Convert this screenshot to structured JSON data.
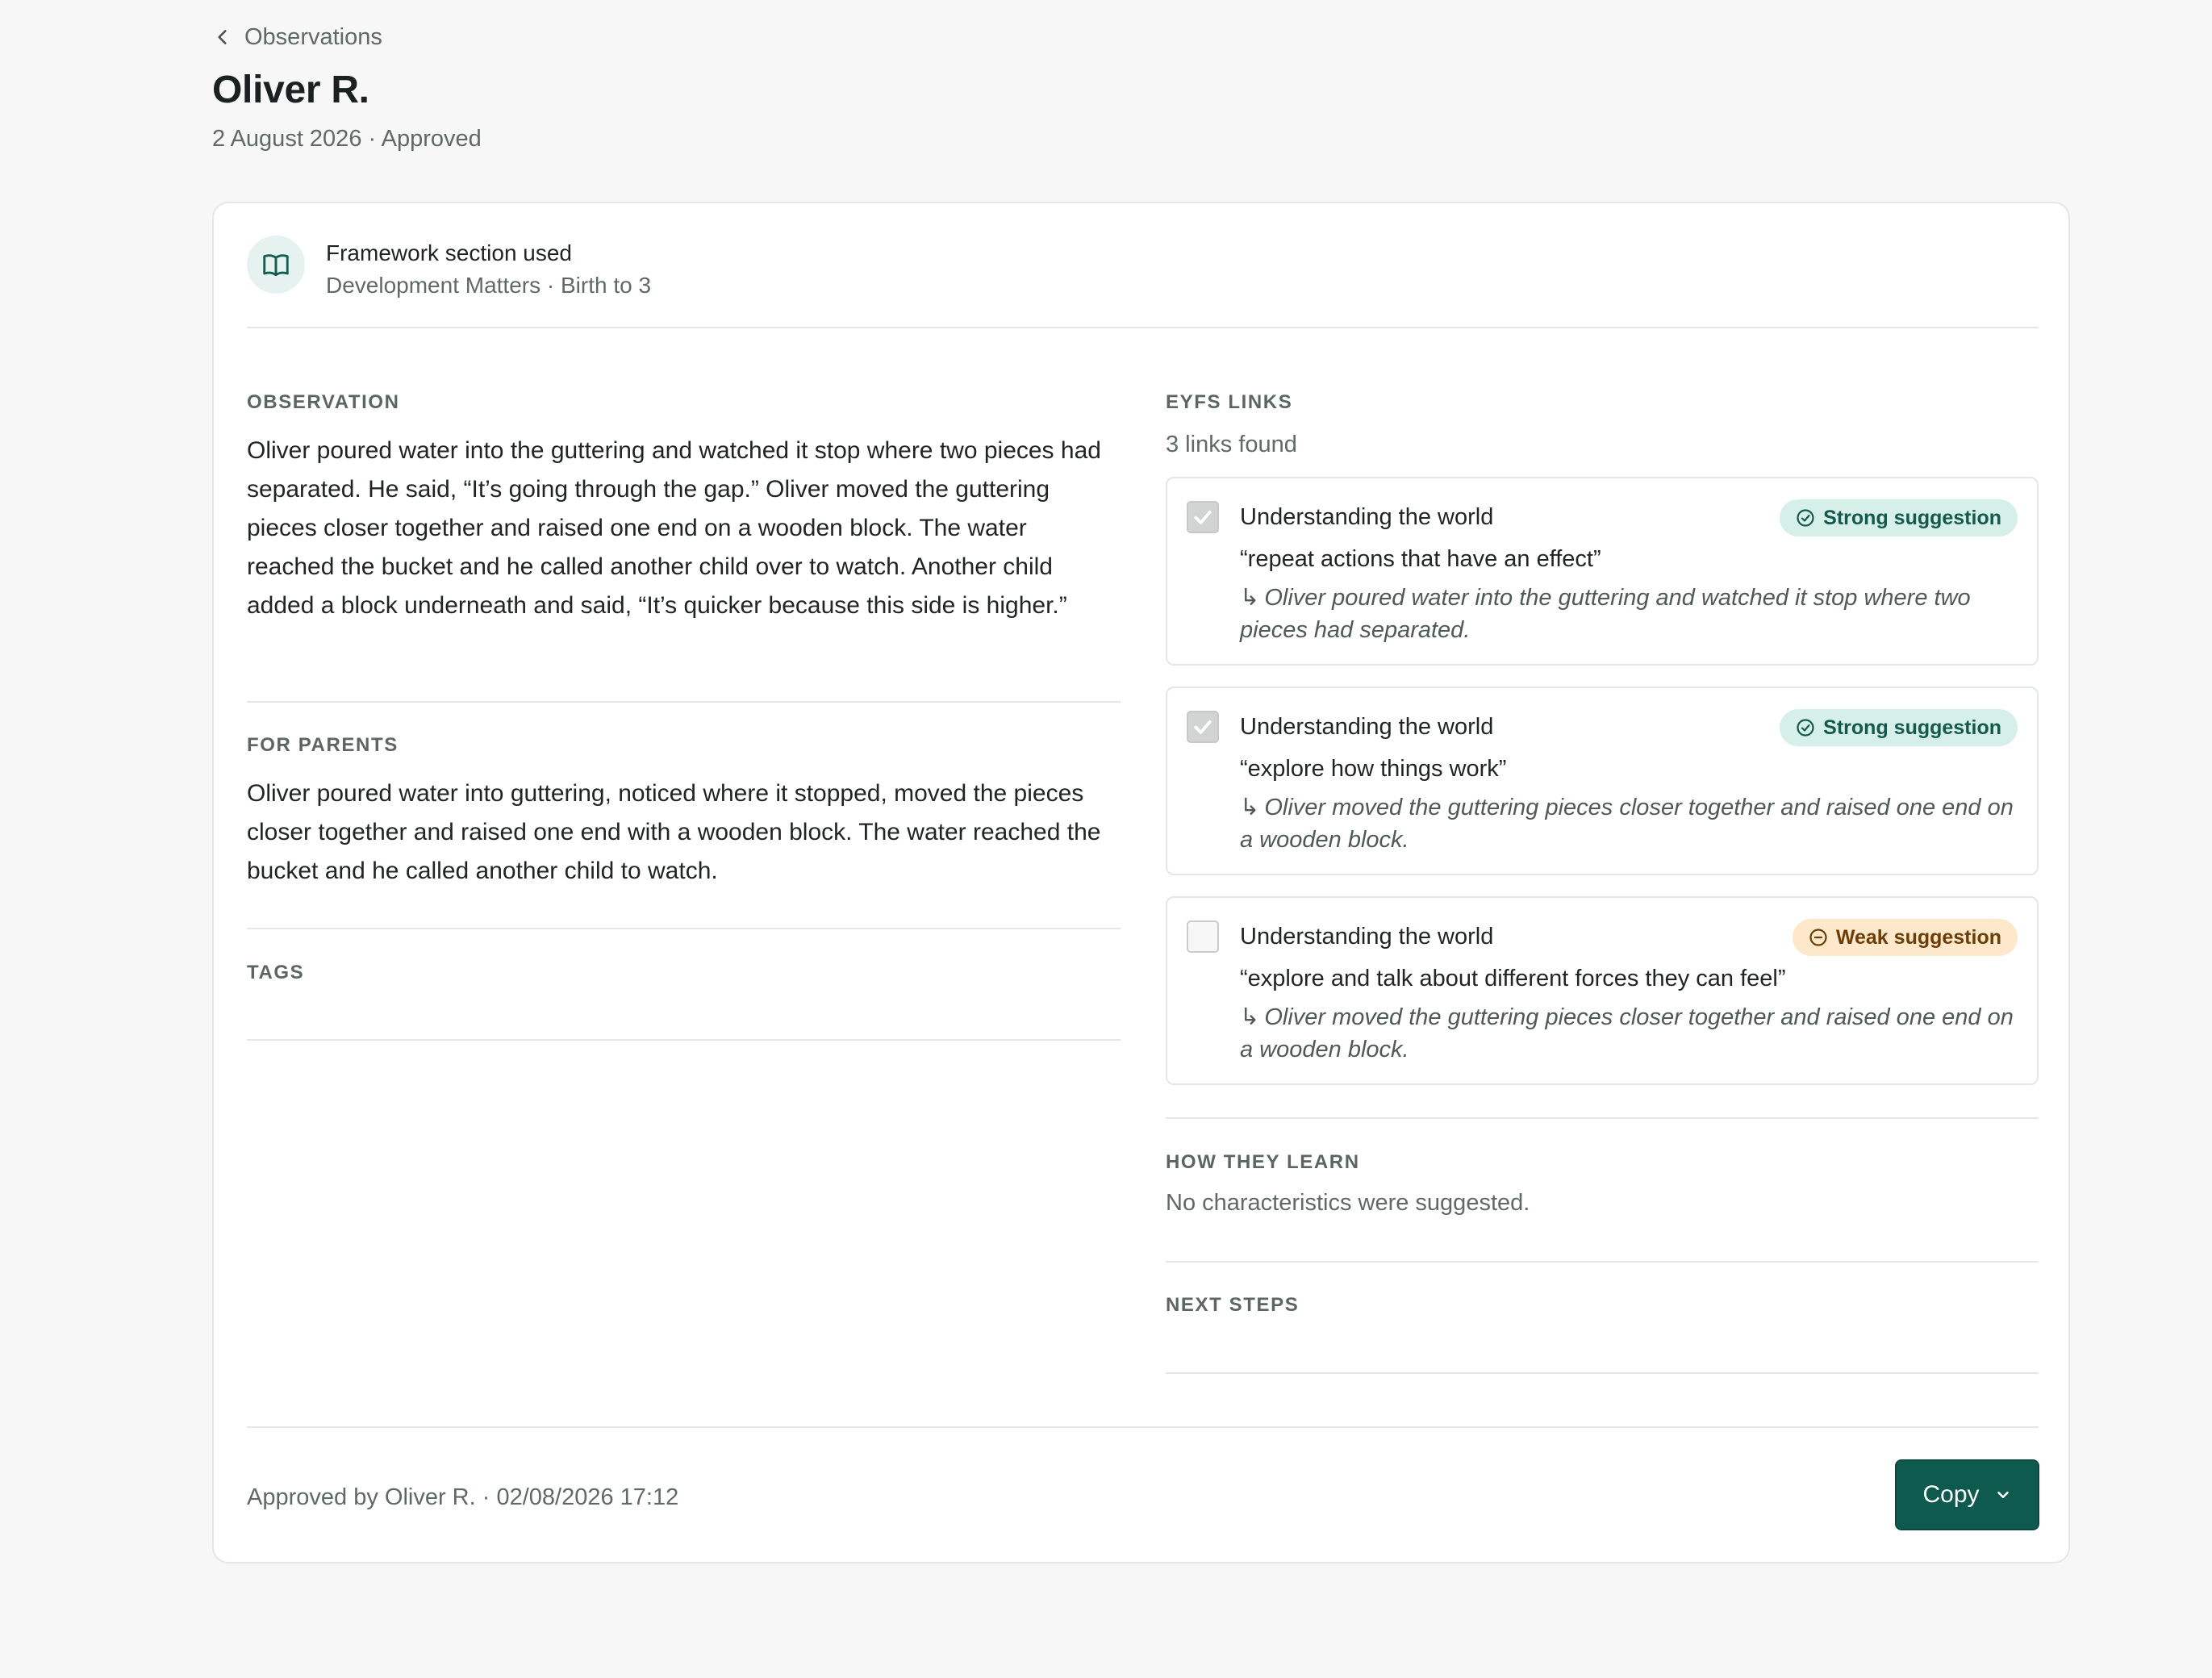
{
  "breadcrumb": {
    "back_label": "Observations"
  },
  "header": {
    "title": "Oliver R.",
    "subtitle": "2 August 2026 · Approved"
  },
  "framework": {
    "title": "Framework section used",
    "value": "Development Matters · Birth to 3",
    "icon": "book-icon"
  },
  "observation": {
    "label": "Observation",
    "text": "Oliver poured water into the guttering and watched it stop where two pieces had separated. He said, “It’s going through the gap.” Oliver moved the guttering pieces closer together and raised one end on a wooden block. The water reached the bucket and he called another child over to watch. Another child added a block underneath and said, “It’s quicker because this side is higher.”"
  },
  "for_parents": {
    "label": "For parents",
    "text": "Oliver poured water into guttering, noticed where it stopped, moved the pieces closer together and raised one end with a wooden block. The water reached the bucket and he called another child to watch."
  },
  "tags": {
    "label": "Tags"
  },
  "eyfs": {
    "label": "EYFS links",
    "count_text": "3 links found",
    "links": [
      {
        "area": "Understanding the world",
        "statement": "“repeat actions that have an effect”",
        "evidence": "Oliver poured water into the guttering and watched it stop where two pieces had separated.",
        "badge": "Strong suggestion",
        "strength": "strong",
        "checked": true
      },
      {
        "area": "Understanding the world",
        "statement": "“explore how things work”",
        "evidence": "Oliver moved the guttering pieces closer together and raised one end on a wooden block.",
        "badge": "Strong suggestion",
        "strength": "strong",
        "checked": true
      },
      {
        "area": "Understanding the world",
        "statement": "“explore and talk about different forces they can feel”",
        "evidence": "Oliver moved the guttering pieces closer together and raised one end on a wooden block.",
        "badge": "Weak suggestion",
        "strength": "weak",
        "checked": false
      }
    ]
  },
  "how_they_learn": {
    "label": "How they learn",
    "text": "No characteristics were suggested."
  },
  "next_steps": {
    "label": "Next steps"
  },
  "footer": {
    "approved_text": "Approved by Oliver R. · 02/08/2026 17:12",
    "copy_label": "Copy"
  },
  "colors": {
    "accent": "#0e5a4e",
    "strong_badge_bg": "#d7efe9",
    "weak_badge_bg": "#fde8cc",
    "background": "#f6f7f6"
  }
}
